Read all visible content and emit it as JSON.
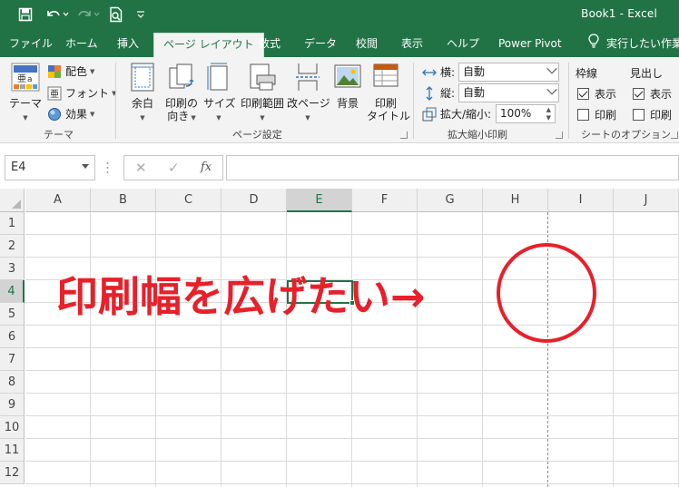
{
  "window": {
    "title": "Book1  -  Excel"
  },
  "quick_access": {
    "save": "save-icon",
    "undo": "undo-icon",
    "redo": "redo-icon",
    "print_preview": "print-preview-icon",
    "customize": "customize-icon"
  },
  "tabs": [
    {
      "label": "ファイル"
    },
    {
      "label": "ホーム"
    },
    {
      "label": "挿入"
    },
    {
      "label": "ページ レイアウト"
    },
    {
      "label": "数式"
    },
    {
      "label": "データ"
    },
    {
      "label": "校閲"
    },
    {
      "label": "表示"
    },
    {
      "label": "ヘルプ"
    },
    {
      "label": "Power Pivot"
    }
  ],
  "tell_me": {
    "label": "実行したい作業"
  },
  "ribbon": {
    "theme": {
      "theme_button": "テーマ",
      "colors": "配色",
      "fonts": "フォント",
      "effects": "効果",
      "group_label": "テーマ"
    },
    "page_setup": {
      "margins": "余白",
      "orientation_line1": "印刷の",
      "orientation_line2": "向き",
      "size": "サイズ",
      "print_area": "印刷範囲",
      "breaks": "改ページ",
      "background": "背景",
      "print_titles_line1": "印刷",
      "print_titles_line2": "タイトル",
      "group_label": "ページ設定"
    },
    "scale": {
      "width_label": "横:",
      "width_value": "自動",
      "height_label": "縦:",
      "height_value": "自動",
      "scale_label": "拡大/縮小:",
      "scale_value": "100%",
      "group_label": "拡大縮小印刷"
    },
    "sheet_options": {
      "gridlines": "枠線",
      "headings": "見出し",
      "view": "表示",
      "print": "印刷",
      "gridlines_view": true,
      "gridlines_print": false,
      "headings_view": true,
      "headings_print": false,
      "group_label": "シートのオプション"
    }
  },
  "formula_bar": {
    "name_box": "E4",
    "cancel_icon": "✕",
    "enter_icon": "✓",
    "fx_label": "fx",
    "formula": ""
  },
  "sheet": {
    "columns": [
      "A",
      "B",
      "C",
      "D",
      "E",
      "F",
      "G",
      "H",
      "I",
      "J"
    ],
    "rows": [
      "1",
      "2",
      "3",
      "4",
      "5",
      "6",
      "7",
      "8",
      "9",
      "10",
      "11",
      "12"
    ],
    "selected_cell": "E4"
  },
  "annotation": {
    "text": "印刷幅を広げたい→",
    "color": "#e8202a"
  },
  "colors": {
    "accent": "#217346",
    "annotation_red": "#e8202a"
  }
}
